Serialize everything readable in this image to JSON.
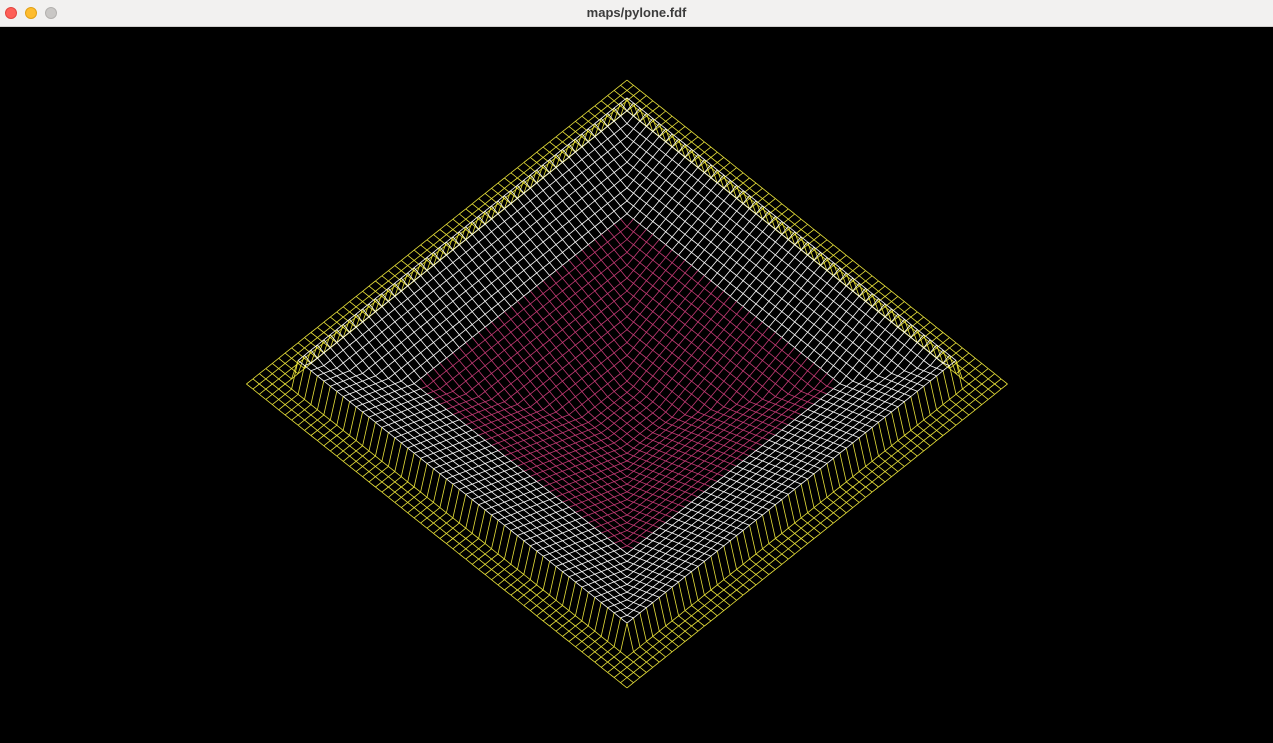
{
  "window": {
    "title": "maps/pylone.fdf",
    "controls": {
      "close_icon": "close-icon",
      "minimize_icon": "minimize-icon",
      "zoom_icon": "zoom-icon"
    }
  },
  "render": {
    "map_name": "pylone",
    "projection": "isometric",
    "background_color": "#000000",
    "colors": {
      "base": "#e8e13a",
      "wall": "#ffffff",
      "pit": "#c23a74"
    }
  }
}
